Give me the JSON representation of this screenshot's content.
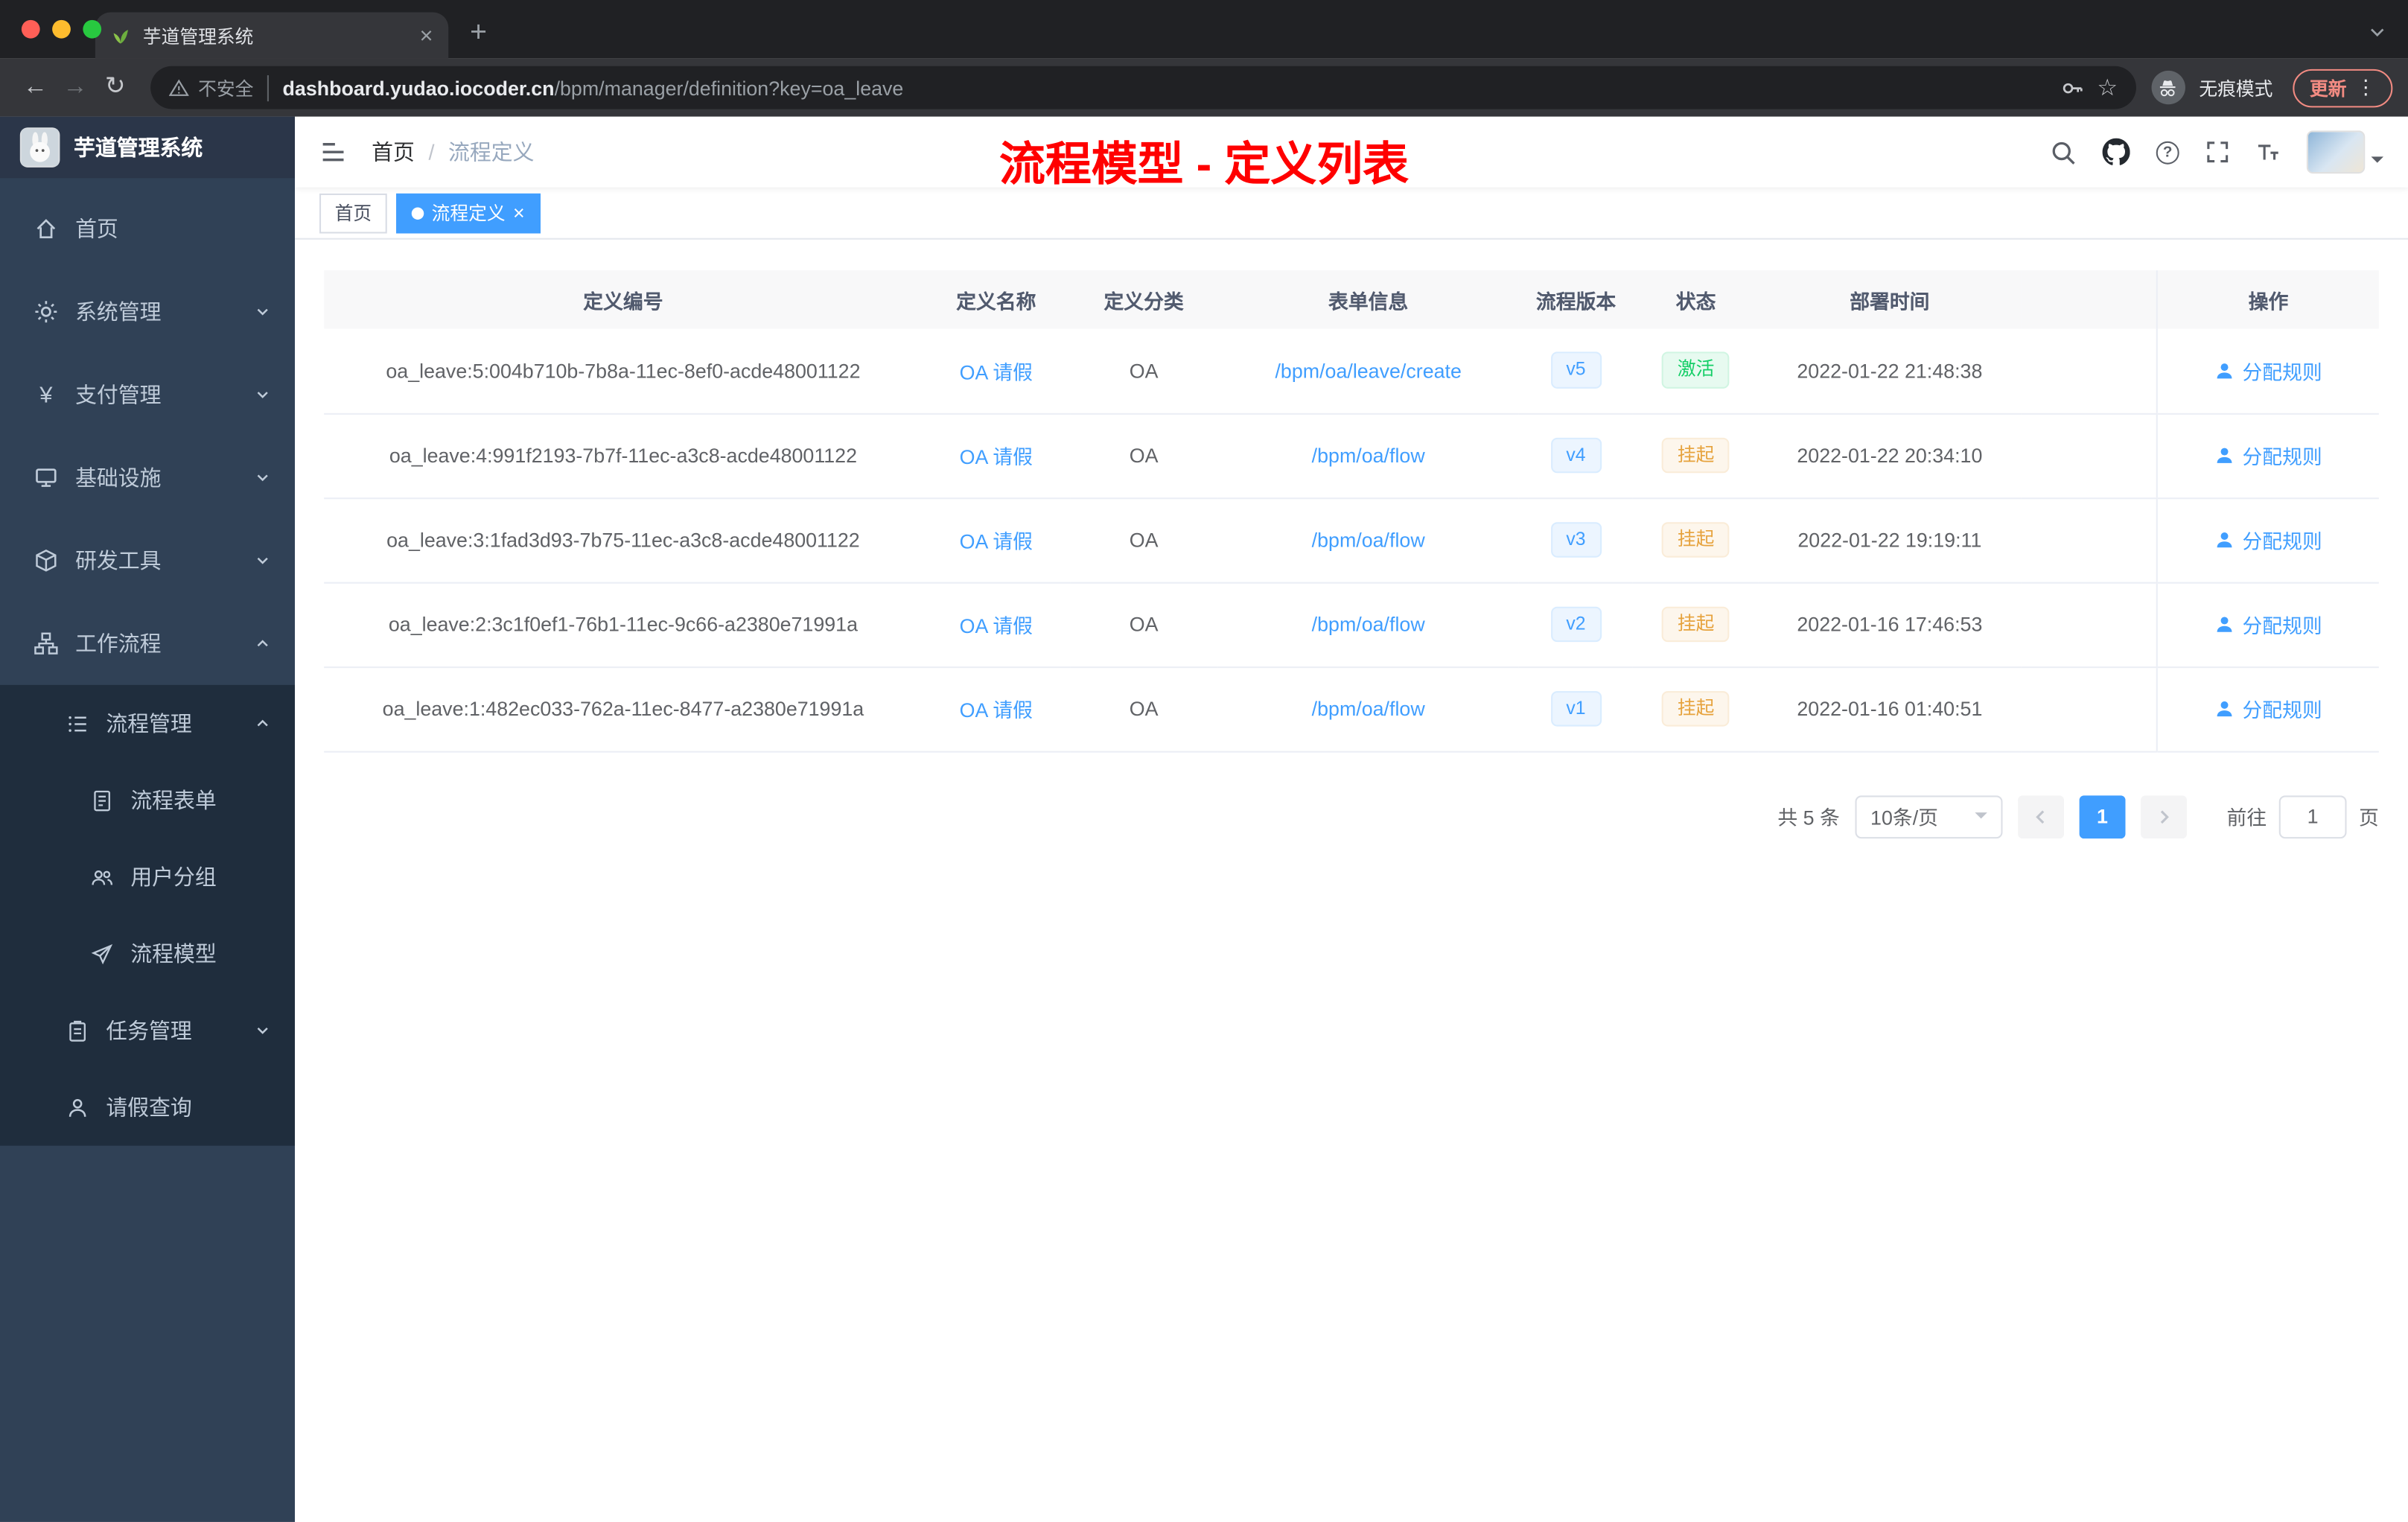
{
  "colors": {
    "accent": "#409eff",
    "success": "#13ce66",
    "warning": "#e6a23c",
    "sidebar_bg": "#304156",
    "sidebar_submenu_bg": "#1f2d3d",
    "annotation_red": "#ff0000",
    "browser_dark": "#202124",
    "browser_toolbar": "#35363a"
  },
  "browser": {
    "tab_title": "芋道管理系统",
    "security_label": "不安全",
    "url_domain": "dashboard.yudao.iocoder.cn",
    "url_path": "/bpm/manager/definition?key=oa_leave",
    "incognito_label": "无痕模式",
    "update_label": "更新"
  },
  "sidebar": {
    "logo_title": "芋道管理系统",
    "items": [
      {
        "label": "首页"
      },
      {
        "label": "系统管理"
      },
      {
        "label": "支付管理"
      },
      {
        "label": "基础设施"
      },
      {
        "label": "研发工具"
      },
      {
        "label": "工作流程"
      }
    ],
    "sub_items": [
      {
        "label": "流程管理"
      },
      {
        "label": "流程表单"
      },
      {
        "label": "用户分组"
      },
      {
        "label": "流程模型"
      },
      {
        "label": "任务管理"
      },
      {
        "label": "请假查询"
      }
    ]
  },
  "header": {
    "breadcrumb_home": "首页",
    "breadcrumb_separator": "/",
    "breadcrumb_current": "流程定义",
    "annotation": "流程模型 - 定义列表"
  },
  "tags": {
    "home": "首页",
    "current": "流程定义"
  },
  "table": {
    "columns": [
      "定义编号",
      "定义名称",
      "定义分类",
      "表单信息",
      "流程版本",
      "状态",
      "部署时间",
      "操作"
    ],
    "rows": [
      {
        "id": "oa_leave:5:004b710b-7b8a-11ec-8ef0-acde48001122",
        "name": "OA 请假",
        "category": "OA",
        "form": "/bpm/oa/leave/create",
        "version": "v5",
        "status": "激活",
        "time": "2022-01-22 21:48:38",
        "action": "分配规则"
      },
      {
        "id": "oa_leave:4:991f2193-7b7f-11ec-a3c8-acde48001122",
        "name": "OA 请假",
        "category": "OA",
        "form": "/bpm/oa/flow",
        "version": "v4",
        "status": "挂起",
        "time": "2022-01-22 20:34:10",
        "action": "分配规则"
      },
      {
        "id": "oa_leave:3:1fad3d93-7b75-11ec-a3c8-acde48001122",
        "name": "OA 请假",
        "category": "OA",
        "form": "/bpm/oa/flow",
        "version": "v3",
        "status": "挂起",
        "time": "2022-01-22 19:19:11",
        "action": "分配规则"
      },
      {
        "id": "oa_leave:2:3c1f0ef1-76b1-11ec-9c66-a2380e71991a",
        "name": "OA 请假",
        "category": "OA",
        "form": "/bpm/oa/flow",
        "version": "v2",
        "status": "挂起",
        "time": "2022-01-16 17:46:53",
        "action": "分配规则"
      },
      {
        "id": "oa_leave:1:482ec033-762a-11ec-8477-a2380e71991a",
        "name": "OA 请假",
        "category": "OA",
        "form": "/bpm/oa/flow",
        "version": "v1",
        "status": "挂起",
        "time": "2022-01-16 01:40:51",
        "action": "分配规则"
      }
    ]
  },
  "pagination": {
    "total": "共 5 条",
    "page_size": "10条/页",
    "current_page": "1",
    "goto_label": "前往",
    "goto_value": "1",
    "page_unit": "页"
  },
  "icons": [
    "leaf-favicon",
    "back-arrow",
    "forward-arrow",
    "reload",
    "warning-triangle",
    "key",
    "bookmark-star",
    "incognito",
    "kebab-menu",
    "hamburger",
    "search",
    "github",
    "question-circle",
    "fullscreen",
    "font-size",
    "chevron-down",
    "chevron-up",
    "home",
    "gear",
    "yen",
    "monitor",
    "cube",
    "tree",
    "list",
    "document",
    "user-group",
    "paper-plane",
    "clipboard",
    "person"
  ]
}
